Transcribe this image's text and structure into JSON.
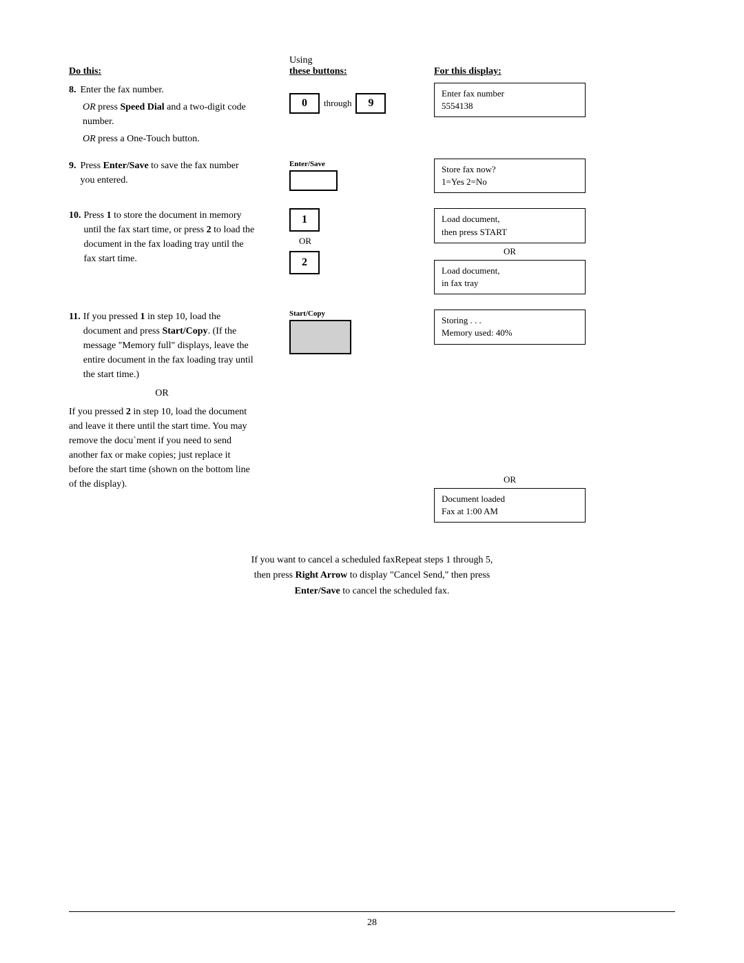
{
  "header": {
    "col1_label": "Do this:",
    "col2_line1": "Using",
    "col2_line2": "these buttons:",
    "col3_label": "For this display:"
  },
  "steps": {
    "step8": {
      "number": "8.",
      "main": "Enter the fax number.",
      "or1": "OR press Speed Dial and a two-digit code number.",
      "or2": "OR press a One-Touch button.",
      "button_0": "0",
      "through": "through",
      "button_9": "9",
      "display_line1": "Enter fax number",
      "display_line2": "5554138"
    },
    "step9": {
      "number": "9.",
      "main_bold": "Enter/Save",
      "main_rest": " to save the fax number you entered.",
      "press": "Press ",
      "button_label": "Enter/Save",
      "display_line1": "Store fax now?",
      "display_line2": "1=Yes   2=No"
    },
    "step10": {
      "number": "10.",
      "main": "Press 1 to store the document in memory until the fax start time, or press 2 to load the document in the fax loading tray until the fax start time.",
      "button_1": "1",
      "button_2": "2",
      "or_text": "OR",
      "display1_line1": "Load document,",
      "display1_line2": "then press START",
      "display_or": "OR",
      "display2_line1": "Load document,",
      "display2_line2": "in fax tray"
    },
    "step11": {
      "number": "11.",
      "main_part1": "If you pressed ",
      "bold1": "1",
      "main_part2": " in step 10, load the document and press ",
      "bold2": "Start/Copy",
      "main_part3": ". (If the message \"Memory full\" displays, leave the entire document in the fax loading tray until the start time.)",
      "or_text": "OR",
      "button_label": "Start/Copy",
      "display1_line1": "Storing . . .",
      "display1_line2": "Memory used: 40%",
      "or2_text": "OR",
      "display2_line1": "Document loaded",
      "display2_line2": "Fax at 1:00 AM",
      "part2_text": "If you pressed ",
      "bold3": "2",
      "part2_rest": " in step 10, load the document and leave it there until the start time. You may remove the docu`ment if you need to send another fax or make copies; just replace it before the start time (shown on the bottom line of the display)."
    }
  },
  "bottom_note": {
    "line1": "If you want to cancel a scheduled faxRepeat steps 1 through 5,",
    "line2_prefix": "then press ",
    "line2_bold": "Right Arrow",
    "line2_rest": " to display \"Cancel Send,\" then press",
    "line3_bold": "Enter/Save",
    "line3_rest": " to cancel the scheduled fax."
  },
  "footer": {
    "page_number": "28"
  }
}
